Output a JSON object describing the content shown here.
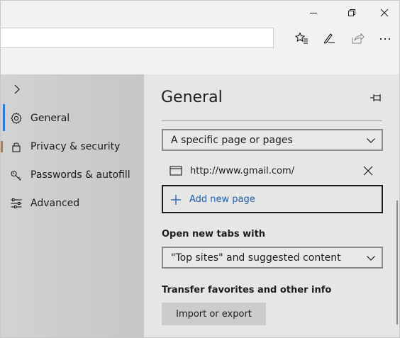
{
  "titlebar": {
    "buttons": [
      {
        "name": "minimize-icon"
      },
      {
        "name": "restore-icon"
      },
      {
        "name": "close-icon"
      }
    ]
  },
  "toolbar": {
    "address_value": "",
    "buttons": [
      "favorites-star-icon",
      "pen-icon",
      "share-icon",
      "more-icon"
    ],
    "more_label": "···"
  },
  "nav": {
    "items": [
      {
        "label": "General",
        "icon": "gear-icon",
        "active": true
      },
      {
        "label": "Privacy & security",
        "icon": "lock-icon"
      },
      {
        "label": "Passwords & autofill",
        "icon": "key-icon"
      },
      {
        "label": "Advanced",
        "icon": "sliders-icon"
      }
    ]
  },
  "panel": {
    "title": "General",
    "open_with_value": "A specific page or pages",
    "pages": [
      {
        "url": "http://www.gmail.com/"
      }
    ],
    "add_page_label": "Add new page",
    "new_tabs_label": "Open new tabs with",
    "new_tabs_value": "\"Top sites\" and suggested content",
    "transfer_label": "Transfer favorites and other info",
    "import_button": "Import or export"
  },
  "colors": {
    "accent": "#2d7bd6",
    "link": "#1d5fae",
    "panel_bg": "#e6e6e6",
    "chrome_bg": "#f2f2f2"
  }
}
